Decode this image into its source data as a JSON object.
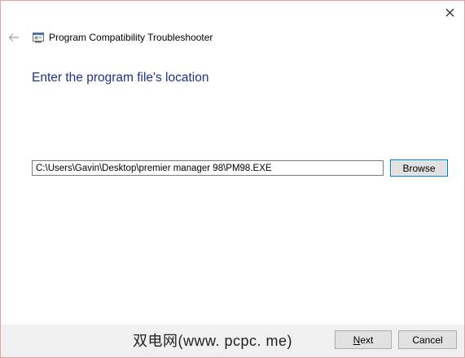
{
  "window": {
    "close_icon": "close-icon",
    "back_icon": "back-arrow-icon",
    "app_icon": "troubleshooter-icon",
    "title": "Program Compatibility Troubleshooter"
  },
  "main": {
    "heading": "Enter the program file's location",
    "path_field": {
      "value": "C:\\Users\\Gavin\\Desktop\\premier manager 98\\PM98.EXE"
    },
    "browse_label": "Browse"
  },
  "footer": {
    "watermark": "双电网(www. pcpc. me)",
    "next": {
      "accel": "N",
      "rest": "ext"
    },
    "cancel_label": "Cancel"
  },
  "colors": {
    "heading": "#1e3287",
    "footer_bg": "#f0f0f0",
    "focus_border": "#0078d7",
    "window_border": "#e8a0a0"
  }
}
